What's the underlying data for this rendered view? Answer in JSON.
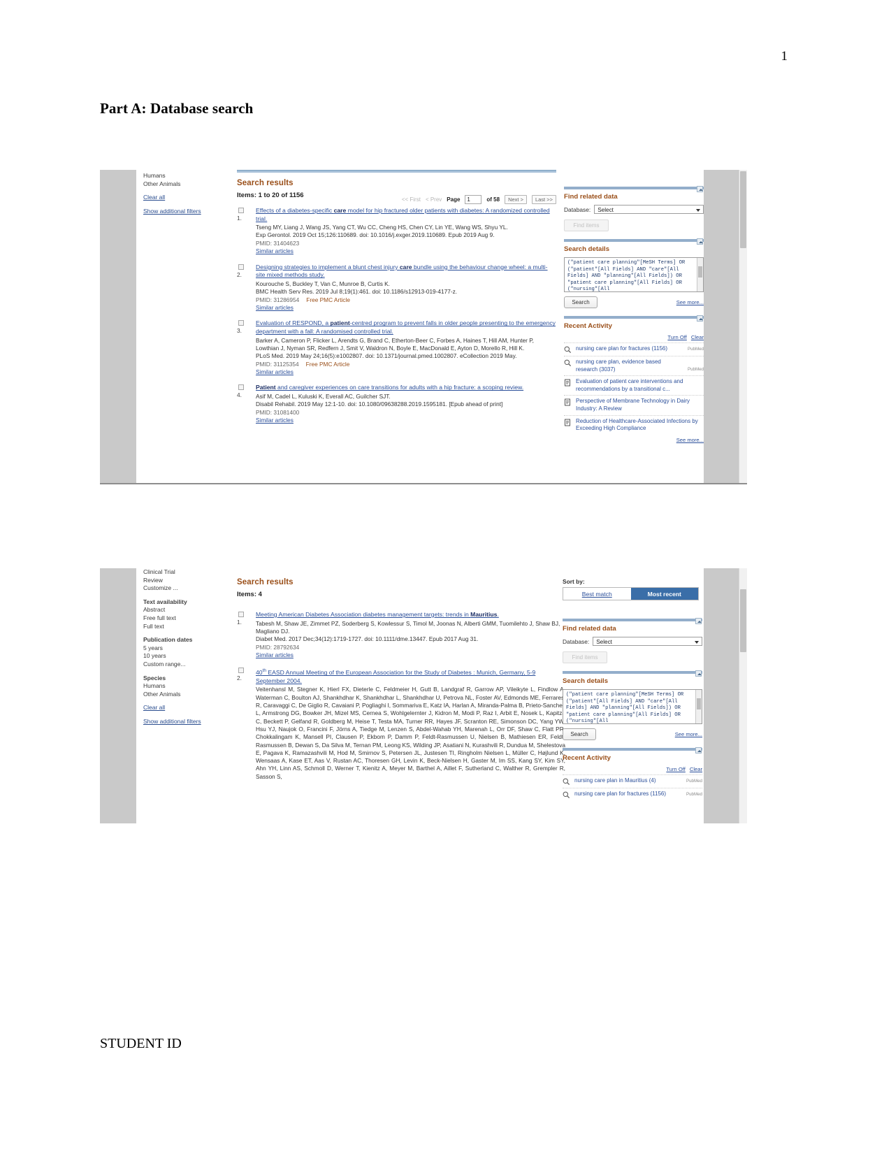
{
  "page": {
    "number": "1",
    "heading": "Part A: Database search",
    "footer": "STUDENT ID"
  },
  "screenshot_one": {
    "filters": {
      "species_items": [
        "Humans",
        "Other Animals"
      ],
      "clear_all": "Clear all",
      "show_additional": "Show additional filters"
    },
    "results_header": {
      "title": "Search results",
      "count": "Items: 1 to 20 of 1156"
    },
    "pager": {
      "first": "<< First",
      "prev": "< Prev",
      "page_label": "Page",
      "page_value": "1",
      "of_label": "of 58",
      "next": "Next >",
      "last": "Last >>"
    },
    "results": [
      {
        "index": "1.",
        "title_pre": "Effects of a diabetes-specific ",
        "title_bold": "care",
        "title_post": " model for hip fractured older patients with diabetes: A randomized controlled trial.",
        "authors": "Tseng MY, Liang J, Wang JS, Yang CT, Wu CC, Cheng HS, Chen CY, Lin YE, Wang WS, Shyu YL.",
        "journal": "Exp Gerontol. 2019 Oct 15;126:110689. doi: 10.1016/j.exger.2019.110689. Epub 2019 Aug 9.",
        "pmid": "PMID: 31404623",
        "free": "",
        "similar": "Similar articles"
      },
      {
        "index": "2.",
        "title_pre": "Designing strategies to implement a blunt chest injury ",
        "title_bold": "care",
        "title_post": " bundle using the behaviour change wheel: a multi-site mixed methods study.",
        "authors": "Kourouche S, Buckley T, Van C, Munroe B, Curtis K.",
        "journal": "BMC Health Serv Res. 2019 Jul 8;19(1):461. doi: 10.1186/s12913-019-4177-z.",
        "pmid": "PMID: 31286954",
        "free": "Free PMC Article",
        "similar": "Similar articles"
      },
      {
        "index": "3.",
        "title_pre": "Evaluation of RESPOND, a ",
        "title_bold": "patient",
        "title_post": "-centred program to prevent falls in older people presenting to the emergency department with a fall: A randomised controlled trial.",
        "authors": "Barker A, Cameron P, Flicker L, Arendts G, Brand C, Etherton-Beer C, Forbes A, Haines T, Hill AM, Hunter P, Lowthian J, Nyman SR, Redfern J, Smit V, Waldron N, Boyle E, MacDonald E, Ayton D, Morello R, Hill K.",
        "journal": "PLoS Med. 2019 May 24;16(5):e1002807. doi: 10.1371/journal.pmed.1002807. eCollection 2019 May.",
        "pmid": "PMID: 31125354",
        "free": "Free PMC Article",
        "similar": "Similar articles"
      },
      {
        "index": "4.",
        "title_pre": "",
        "title_bold": "Patient",
        "title_post": " and caregiver experiences on care transitions for adults with a hip fracture: a scoping review.",
        "authors": "Asif M, Cadel L, Kuluski K, Everall AC, Guilcher SJT.",
        "journal": "Disabil Rehabil. 2019 May 12:1-10. doi: 10.1080/09638288.2019.1595181. [Epub ahead of print]",
        "pmid": "PMID: 31081400",
        "free": "",
        "similar": "Similar articles"
      }
    ],
    "rail": {
      "find_related": {
        "heading": "Find related data",
        "database_label": "Database:",
        "database_value": "Select",
        "find_items_label": "Find items"
      },
      "search_details": {
        "heading": "Search details",
        "query": "(\"patient care planning\"[MeSH Terms] OR (\"patient\"[All Fields] AND \"care\"[All Fields] AND \"planning\"[All Fields]) OR \"patient care planning\"[All Fields] OR (\"nursing\"[All",
        "search_button": "Search",
        "see_more": "See more..."
      },
      "recent_activity": {
        "heading": "Recent Activity",
        "turn_off": "Turn Off",
        "clear": "Clear",
        "see_more": "See more...",
        "items": [
          {
            "icon": "search-icon",
            "text": "nursing care plan for fractures (1156)",
            "tag": "PubMed"
          },
          {
            "icon": "search-icon",
            "text": "nursing care plan, evidence based research (3037)",
            "tag": "PubMed"
          },
          {
            "icon": "document-icon",
            "text": "Evaluation of patient care interventions and recommendations by a transitional c...",
            "tag": ""
          },
          {
            "icon": "document-icon",
            "text": "Perspective of Membrane Technology in Dairy Industry: A Review",
            "tag": ""
          },
          {
            "icon": "document-icon",
            "text": "Reduction of Healthcare-Associated Infections by Exceeding High Compliance",
            "tag": ""
          }
        ]
      }
    }
  },
  "screenshot_two": {
    "filters": {
      "article_types": [
        "Clinical Trial",
        "Review",
        "Customize ..."
      ],
      "text_availability_title": "Text availability",
      "text_availability": [
        "Abstract",
        "Free full text",
        "Full text"
      ],
      "publication_dates_title": "Publication dates",
      "publication_dates": [
        "5 years",
        "10 years",
        "Custom range..."
      ],
      "species_title": "Species",
      "species": [
        "Humans",
        "Other Animals"
      ],
      "clear_all": "Clear all",
      "show_additional": "Show additional filters"
    },
    "results_header": {
      "title": "Search results",
      "count": "Items: 4"
    },
    "sort_by": {
      "label": "Sort by:",
      "best_match": "Best match",
      "most_recent": "Most recent"
    },
    "results": [
      {
        "index": "1.",
        "title_pre": "Meeting American Diabetes Association diabetes management targets: trends in ",
        "title_bold": "Mauritius",
        "title_post": ".",
        "authors": "Tabesh M, Shaw JE, Zimmet PZ, Soderberg S, Kowlessur S, Timol M, Joonas N, Alberti GMM, Tuomilehto J, Shaw BJ, Magliano DJ.",
        "journal": "Diabet Med. 2017 Dec;34(12):1719-1727. doi: 10.1111/dme.13447. Epub 2017 Aug 31.",
        "pmid": "PMID: 28792634",
        "free": "",
        "similar": "Similar articles"
      },
      {
        "index": "2.",
        "title_pre": "40",
        "title_sup": "th",
        "title_bold": "",
        "title_post": " EASD Annual Meeting of the European Association for the Study of Diabetes : Munich, Germany, 5-9 September 2004.",
        "authors": "Veitenhansl M, Stegner K, Hierl FX, Dieterle C, Feldmeier H, Gutt B, Landgraf R, Garrow AP, Vileikyte L, Findlow A, Waterman C, Boulton AJ, Shankhdhar K, Shankhdhar L, Shankhdhar U, Petrova NL, Foster AV, Edmonds ME, Ferraresi R, Caravaggi C, De Giglio R, Cavaiani P, Pogliaghi I, Sommariva E, Katz IA, Harlan A, Miranda-Palma B, Prieto-Sanchez L, Armstrong DG, Bowker JH, Mizel MS, Cernea S, Wohlgelernter J, Kidron M, Modi P, Raz I, Arbit E, Nosek L, Kapitza C, Beckett P, Gelfand R, Goldberg M, Heise T, Testa MA, Turner RR, Hayes JF, Scranton RE, Simonson DC, Yang YW, Hsu YJ, Naujok O, Francini F, Jörns A, Tiedge M, Lenzen S, Abdel-Wahab YH, Marenah L, Orr DF, Shaw C, Flatt PR, Chokkalingam K, Mansell PI, Clausen P, Ekbom P, Damm P, Feldt-Rasmussen U, Nielsen B, Mathiesen ER, Feldt-Rasmussen B, Dewan S, Da Silva M, Ternan PM, Leong KS, Wilding JP, Asatiani N, Kurashvili R, Dundua M, Shelestova E, Pagava K, Ramazashvili M, Hod M, Smirnov S, Petersen JL, Justesen TI, Ringholm Nielsen L, Müller C, Højlund K, Wensaas A, Kase ET, Aas V, Rustan AC, Thoresen GH, Levin K, Beck-Nielsen H, Gaster M, Im SS, Kang SY, Kim SY, Ahn YH, Linn AS, Schmoll D, Werner T, Kienitz A, Meyer M, Barthel A, Aillet F, Sutherland C, Walther R, Grempler R, Sasson S,",
        "journal": "",
        "pmid": "",
        "free": "",
        "similar": ""
      }
    ],
    "rail": {
      "find_related": {
        "heading": "Find related data",
        "database_label": "Database:",
        "database_value": "Select",
        "find_items_label": "Find items"
      },
      "search_details": {
        "heading": "Search details",
        "query": "(\"patient care planning\"[MeSH Terms] OR (\"patient\"[All Fields] AND \"care\"[All Fields] AND \"planning\"[All Fields]) OR \"patient care planning\"[All Fields] OR (\"nursing\"[All",
        "search_button": "Search",
        "see_more": "See more..."
      },
      "recent_activity": {
        "heading": "Recent Activity",
        "turn_off": "Turn Off",
        "clear": "Clear",
        "items": [
          {
            "icon": "search-icon",
            "text": "nursing care plan in Mauritius (4)",
            "tag": "PubMed"
          },
          {
            "icon": "search-icon",
            "text": "nursing care plan for fractures (1156)",
            "tag": "PubMed"
          }
        ]
      }
    }
  }
}
